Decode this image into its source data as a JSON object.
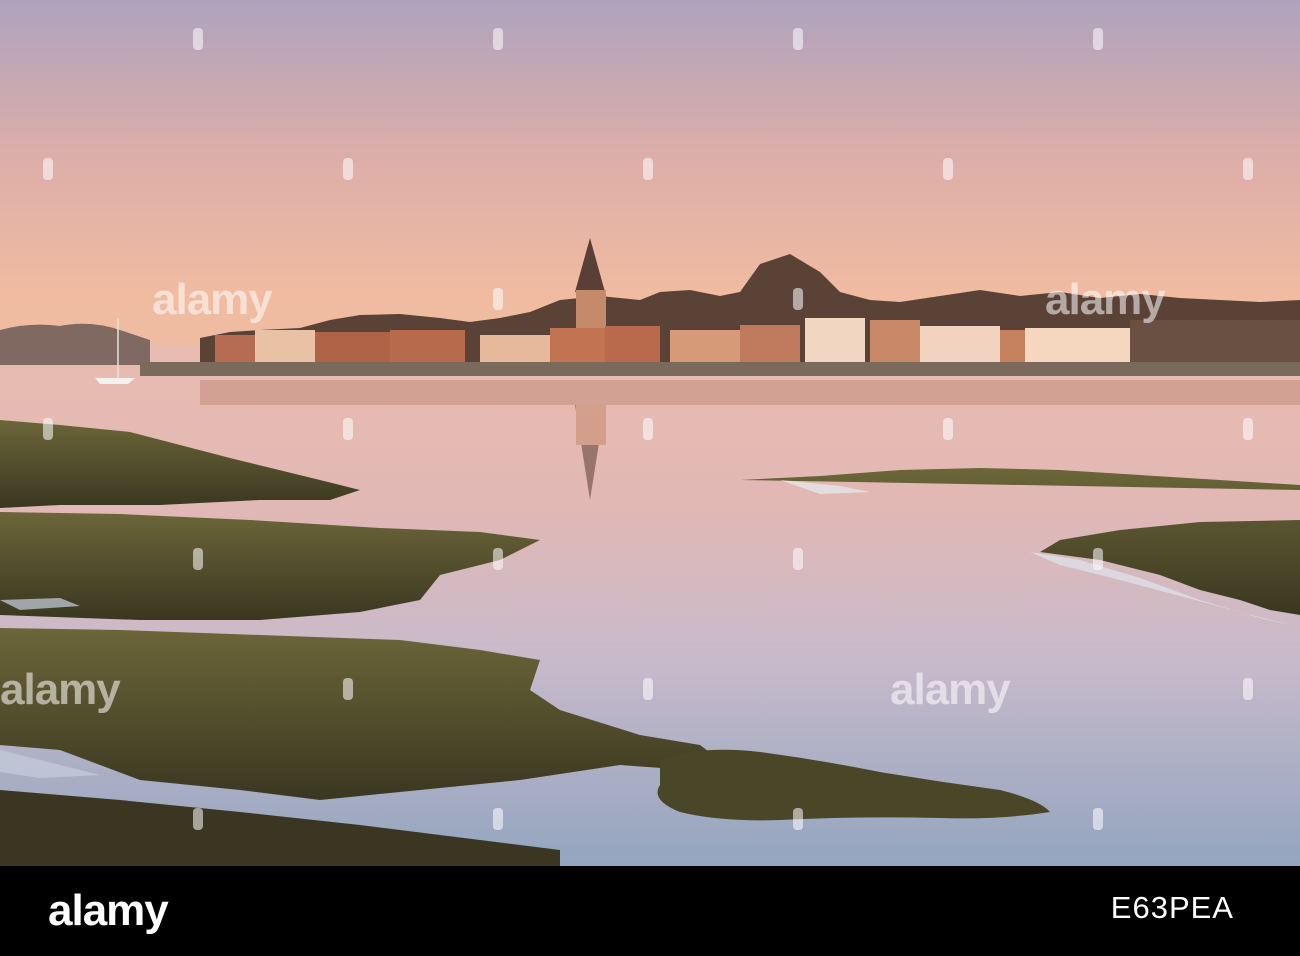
{
  "photo": {
    "subject": "",
    "palette": {
      "sky_top": "#aea3bd",
      "sky_mid": "#e7b6a4",
      "horizon": "#f0bba1",
      "water_light": "#e6b8b0",
      "water_mid": "#c3b7c7",
      "water_deep": "#93a3bd",
      "marsh": "#5e5a33",
      "marsh_dark": "#3c3a22",
      "buildings": "#c77e5d",
      "trees": "#4a3a30"
    }
  },
  "watermarks": {
    "text": "alamy"
  },
  "footer": {
    "logo_text": "alamy",
    "image_id": "E63PEA"
  }
}
